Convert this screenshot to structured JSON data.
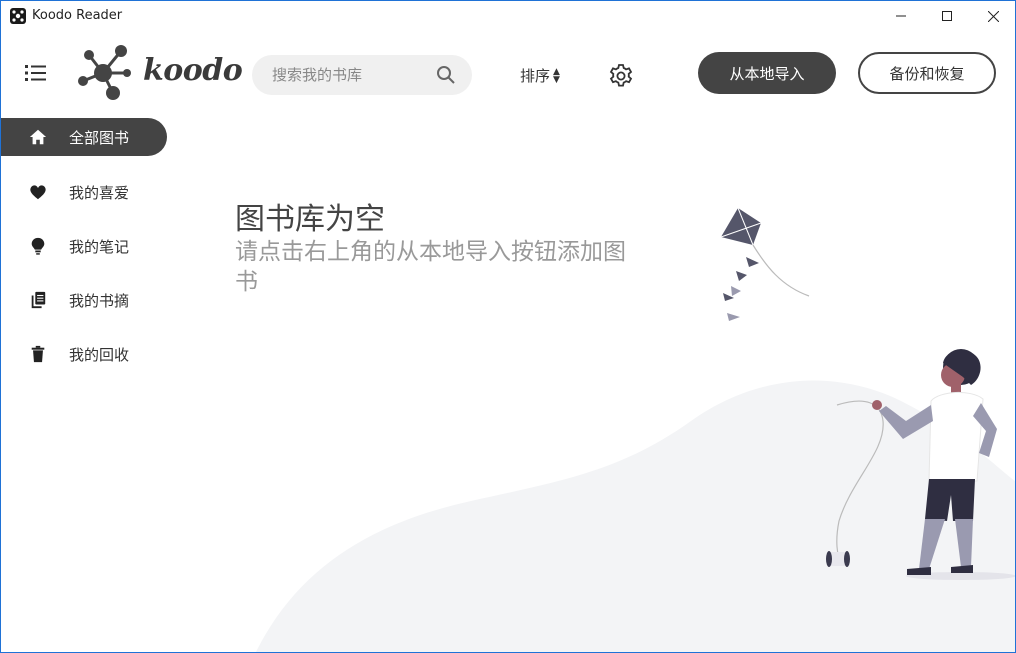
{
  "window": {
    "title": "Koodo Reader"
  },
  "header": {
    "logo_text": "koodo",
    "search_placeholder": "搜索我的书库",
    "sort_label": "排序",
    "import_label": "从本地导入",
    "backup_label": "备份和恢复"
  },
  "sidebar": {
    "items": [
      {
        "label": "全部图书",
        "icon": "home-icon",
        "active": true
      },
      {
        "label": "我的喜爱",
        "icon": "heart-icon",
        "active": false
      },
      {
        "label": "我的笔记",
        "icon": "lightbulb-icon",
        "active": false
      },
      {
        "label": "我的书摘",
        "icon": "copy-icon",
        "active": false
      },
      {
        "label": "我的回收",
        "icon": "trash-icon",
        "active": false
      }
    ]
  },
  "empty_state": {
    "title": "图书库为空",
    "subtitle": "请点击右上角的从本地导入按钮添加图书"
  },
  "colors": {
    "accent": "#444444",
    "window_border": "#1f72d6",
    "muted_text": "#999999"
  }
}
